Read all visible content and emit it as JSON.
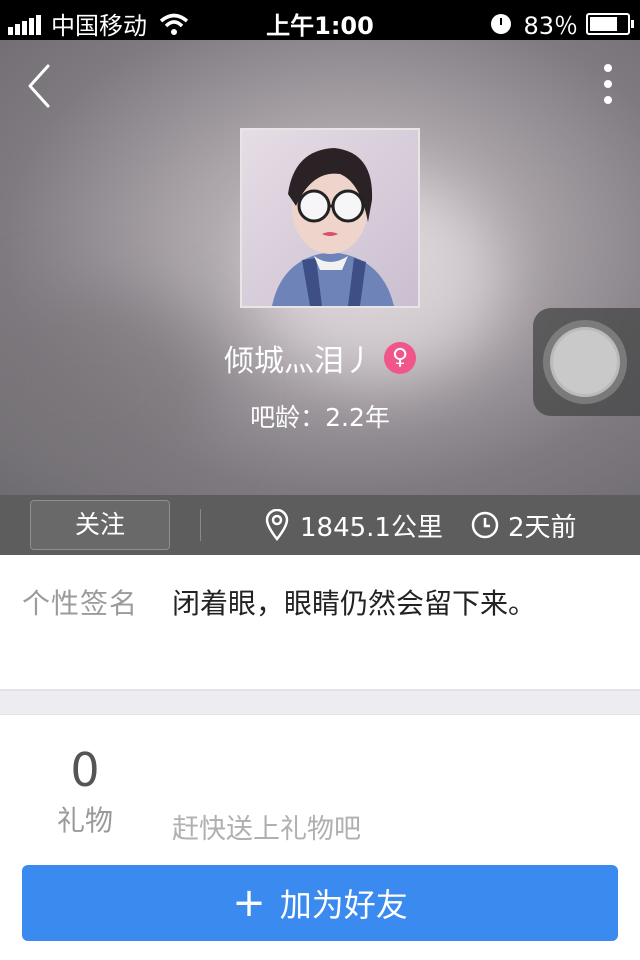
{
  "status_bar": {
    "carrier": "中国移动",
    "time": "上午1:00",
    "battery": "83％",
    "battery_level": 0.83
  },
  "profile": {
    "name": "倾城灬泪丿",
    "gender_symbol": "♀",
    "age_label": "吧龄：2.2年"
  },
  "actions": {
    "follow_label": "关注",
    "distance": "1845.1公里",
    "last_active": "2天前"
  },
  "signature": {
    "label": "个性签名",
    "text": "闭着眼，眼睛仍然会留下来。"
  },
  "gifts": {
    "count": "0",
    "label": "礼物",
    "hint": "赶快送上礼物吧"
  },
  "add_friend": {
    "plus": "+",
    "label": "加为好友"
  },
  "colors": {
    "accent_blue": "#3b8af0",
    "gender_pink": "#f0568a",
    "action_bar": "#5d5d5d"
  }
}
